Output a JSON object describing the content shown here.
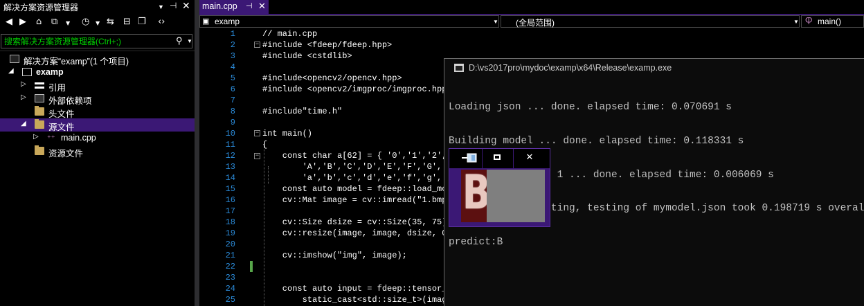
{
  "solution_explorer": {
    "title": "解决方案资源管理器",
    "search_placeholder": "搜索解决方案资源管理器(Ctrl+;)",
    "tree": [
      {
        "label": "解决方案“examp”(1 个项目)"
      },
      {
        "label": "examp"
      },
      {
        "label": "引用"
      },
      {
        "label": "外部依赖项"
      },
      {
        "label": "头文件"
      },
      {
        "label": "源文件"
      },
      {
        "label": "main.cpp"
      },
      {
        "label": "资源文件"
      }
    ]
  },
  "editor": {
    "tab": {
      "label": "main.cpp"
    },
    "nav": {
      "project": "examp",
      "scope": "(全局范围)",
      "member": "main()"
    },
    "lines": [
      {
        "n": "1",
        "code": "// main.cpp"
      },
      {
        "n": "2",
        "code": "#include <fdeep/fdeep.hpp>"
      },
      {
        "n": "3",
        "code": "#include <cstdlib>"
      },
      {
        "n": "4",
        "code": ""
      },
      {
        "n": "5",
        "code": "#include<opencv2/opencv.hpp>"
      },
      {
        "n": "6",
        "code": "#include <opencv2/imgproc/imgproc.hpp>"
      },
      {
        "n": "7",
        "code": ""
      },
      {
        "n": "8",
        "code": "#include\"time.h\""
      },
      {
        "n": "9",
        "code": ""
      },
      {
        "n": "10",
        "code": "int main()"
      },
      {
        "n": "11",
        "code": "{"
      },
      {
        "n": "12",
        "code": "    const char a[62] = { '0','1','2',"
      },
      {
        "n": "13",
        "code": "        'A','B','C','D','E','F','G','H',"
      },
      {
        "n": "14",
        "code": "        'a','b','c','d','e','f','g','h',"
      },
      {
        "n": "15",
        "code": "    const auto model = fdeep::load_model"
      },
      {
        "n": "16",
        "code": "    cv::Mat image = cv::imread(\"1.bmp\""
      },
      {
        "n": "17",
        "code": ""
      },
      {
        "n": "18",
        "code": "    cv::Size dsize = cv::Size(35, 75)"
      },
      {
        "n": "19",
        "code": "    cv::resize(image, image, dsize, 0,"
      },
      {
        "n": "20",
        "code": ""
      },
      {
        "n": "21",
        "code": "    cv::imshow(\"img\", image);"
      },
      {
        "n": "22",
        "code": ""
      },
      {
        "n": "23",
        "code": ""
      },
      {
        "n": "24",
        "code": "    const auto input = fdeep::tensor_f"
      },
      {
        "n": "25",
        "code": "        static_cast<std::size_t>(image"
      }
    ]
  },
  "console": {
    "title": "D:\\vs2017pro\\mydoc\\examp\\x64\\Release\\examp.exe",
    "lines": [
      "Loading json ... done. elapsed time: 0.070691 s",
      "Building model ... done. elapsed time: 0.118331 s",
      "Running test 1 of 1 ... done. elapsed time: 0.006069 s",
      "Loading, constructing, testing of mymodel.json took 0.198719 s overall.",
      "predict:B"
    ]
  },
  "image_window": {
    "minimize_glyph": "—",
    "maximize_glyph": "▫",
    "close_glyph": "✕",
    "letter": "B"
  },
  "colors": {
    "accent": "#3b1875",
    "line_numbers": "#2b8bd9",
    "search_text": "#00d000",
    "change_marker": "#57a64a"
  }
}
